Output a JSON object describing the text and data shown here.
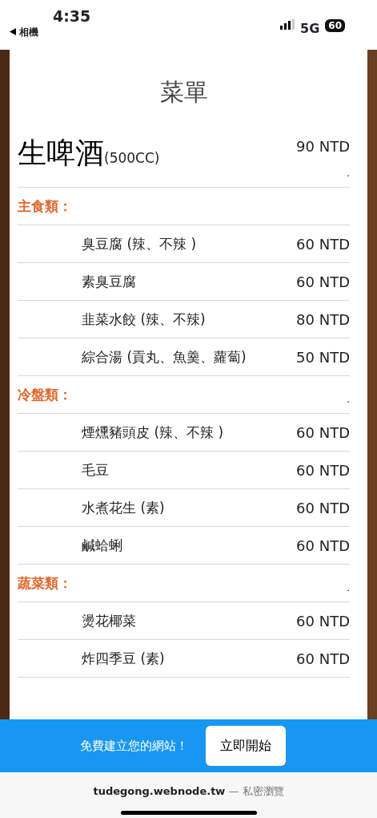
{
  "status_bar": {
    "time": "4:35",
    "back_label": "相機",
    "network": "5G",
    "battery": "60"
  },
  "menu": {
    "title": "菜單",
    "featured": {
      "name": "生啤酒",
      "note": "(500CC)",
      "price": "90 NTD",
      "mark": "."
    },
    "sections": [
      {
        "title": "主食類：",
        "items": [
          {
            "name": "臭豆腐 (辣、不辣 )",
            "price": "60 NTD"
          },
          {
            "name": "素臭豆腐",
            "price": "60 NTD"
          },
          {
            "name": "韭菜水餃 (辣、不辣)",
            "price": "80 NTD"
          },
          {
            "name": "綜合湯 (貢丸、魚羹、蘿蔔)",
            "price": "50 NTD"
          }
        ]
      },
      {
        "title": "冷盤類：",
        "mark": ".",
        "items": [
          {
            "name": "煙燻豬頭皮 (辣、不辣 )",
            "price": "60 NTD"
          },
          {
            "name": "毛豆",
            "price": "60 NTD"
          },
          {
            "name": "水煮花生 (素)",
            "price": "60 NTD"
          },
          {
            "name": "鹹蛤蜊",
            "price": "60 NTD"
          }
        ]
      },
      {
        "title": "蔬菜類：",
        "mark": ".",
        "items": [
          {
            "name": "燙花椰菜",
            "price": "60 NTD"
          },
          {
            "name": "炸四季豆 (素)",
            "price": "60 NTD"
          }
        ]
      }
    ]
  },
  "banner": {
    "text": "免費建立您的網站！",
    "button": "立即開始"
  },
  "address_bar": {
    "url": "tudegong.webnode.tw",
    "note": "— 私密瀏覽"
  }
}
